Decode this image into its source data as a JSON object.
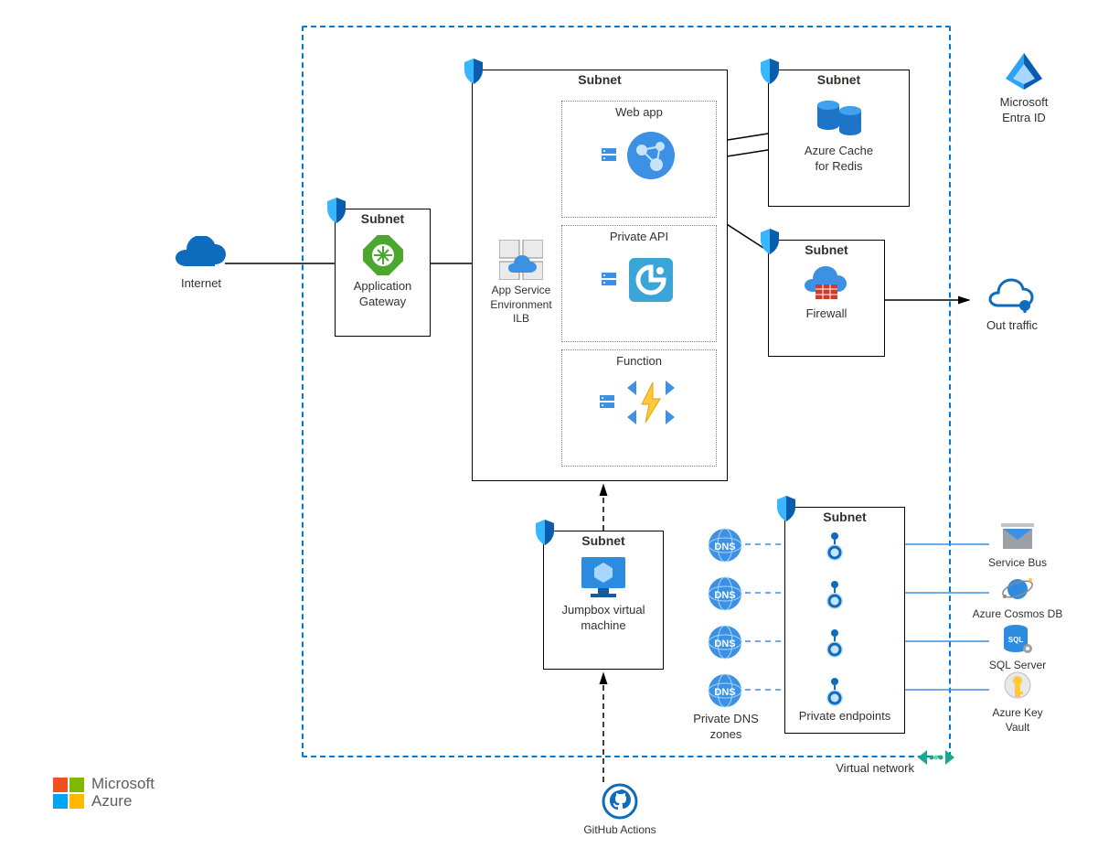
{
  "brand": {
    "line1": "Microsoft",
    "line2": "Azure"
  },
  "vnet_label": "Virtual network",
  "external": {
    "internet": "Internet",
    "entra": "Microsoft\nEntra ID",
    "out_traffic": "Out traffic",
    "github": "GitHub Actions",
    "service_bus": "Service Bus",
    "cosmos": "Azure Cosmos DB",
    "sql": "SQL Server",
    "keyvault": "Azure Key\nVault"
  },
  "subnets": {
    "appgw": {
      "title": "Subnet",
      "label": "Application\nGateway"
    },
    "ase": {
      "title": "Subnet",
      "ilb": "App Service\nEnvironment\nILB",
      "webapp": "Web app",
      "api": "Private API",
      "function": "Function"
    },
    "redis": {
      "title": "Subnet",
      "label": "Azure Cache\nfor Redis"
    },
    "firewall": {
      "title": "Subnet",
      "label": "Firewall"
    },
    "jumpbox": {
      "title": "Subnet",
      "label": "Jumpbox virtual\nmachine"
    },
    "pe": {
      "title": "Subnet",
      "label": "Private endpoints"
    },
    "dns": {
      "label": "Private DNS\nzones",
      "tag": "DNS"
    }
  }
}
